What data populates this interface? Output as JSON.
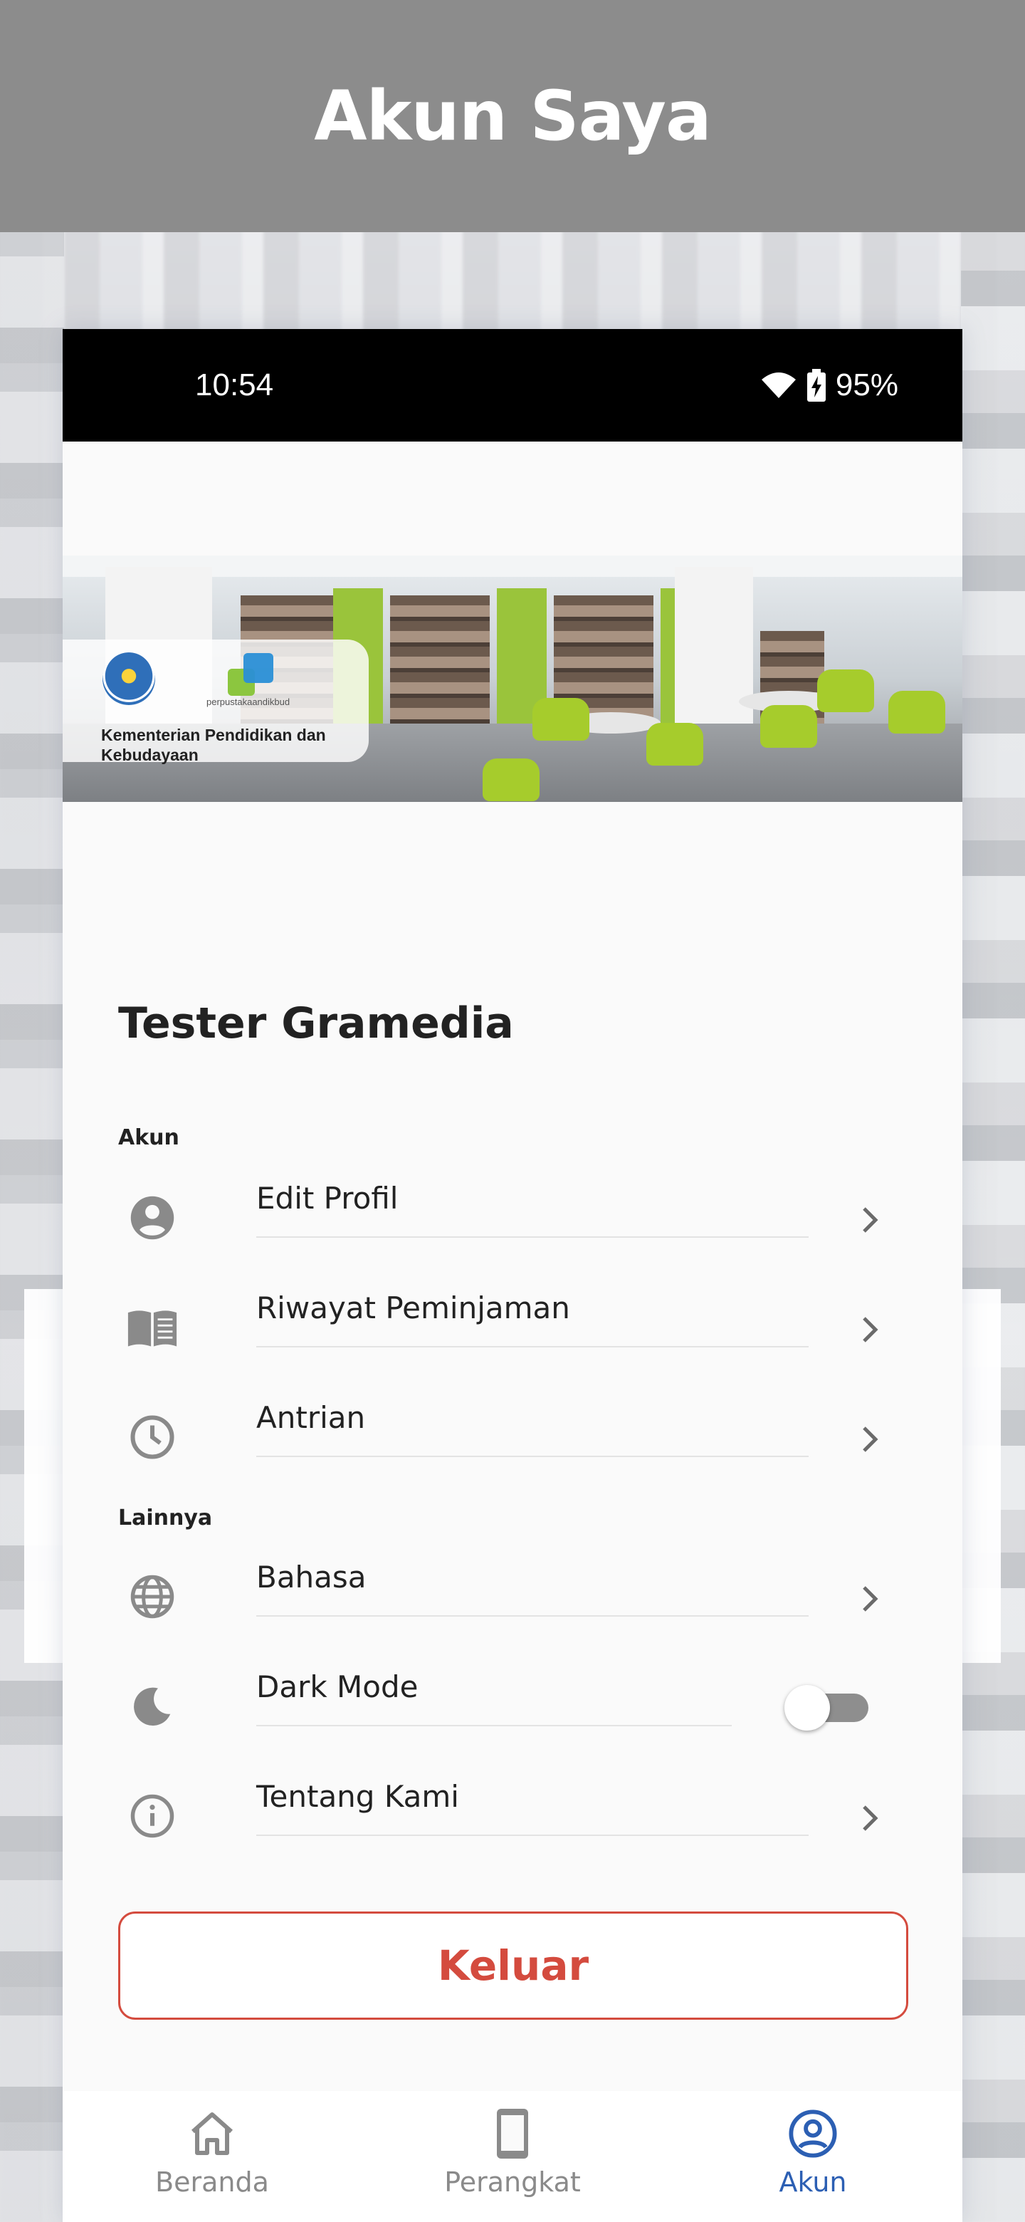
{
  "header": {
    "title": "Akun Saya"
  },
  "status_bar": {
    "time": "10:54",
    "battery": "95%"
  },
  "banner": {
    "ministry_text": "Kementerian Pendidikan dan Kebudayaan",
    "perpus_text": "perpustakaandikbud"
  },
  "profile": {
    "name": "Tester Gramedia"
  },
  "sections": {
    "account_label": "Akun",
    "other_label": "Lainnya"
  },
  "menu": {
    "edit_profile": "Edit Profil",
    "loan_history": "Riwayat Peminjaman",
    "queue": "Antrian",
    "language": "Bahasa",
    "dark_mode": "Dark Mode",
    "about": "Tentang Kami"
  },
  "dark_mode_enabled": false,
  "logout_label": "Keluar",
  "bottom_nav": {
    "home": "Beranda",
    "device": "Perangkat",
    "account": "Akun",
    "active": "account"
  },
  "colors": {
    "header_bg": "#8c8c8c",
    "accent_red": "#d44b3e",
    "active_nav": "#2c5fb3",
    "icon_gray": "#8a8a8a"
  }
}
